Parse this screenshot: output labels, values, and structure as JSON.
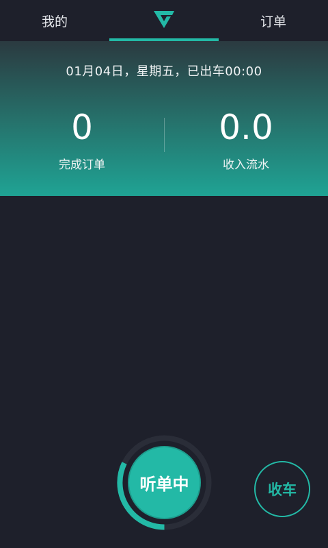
{
  "topnav": {
    "left_tab": "我的",
    "right_tab": "订单",
    "center_icon": "v-logo-icon",
    "accent_color": "#23b9a6"
  },
  "stats": {
    "date_line": "01月04日，星期五，已出车00:00",
    "orders": {
      "value": "0",
      "label": "完成订单"
    },
    "income": {
      "value": "0.0",
      "label": "收入流水"
    }
  },
  "controls": {
    "listen_label": "听单中",
    "finish_label": "收车"
  },
  "colors": {
    "background": "#1e202b",
    "accent": "#23b9a6"
  }
}
